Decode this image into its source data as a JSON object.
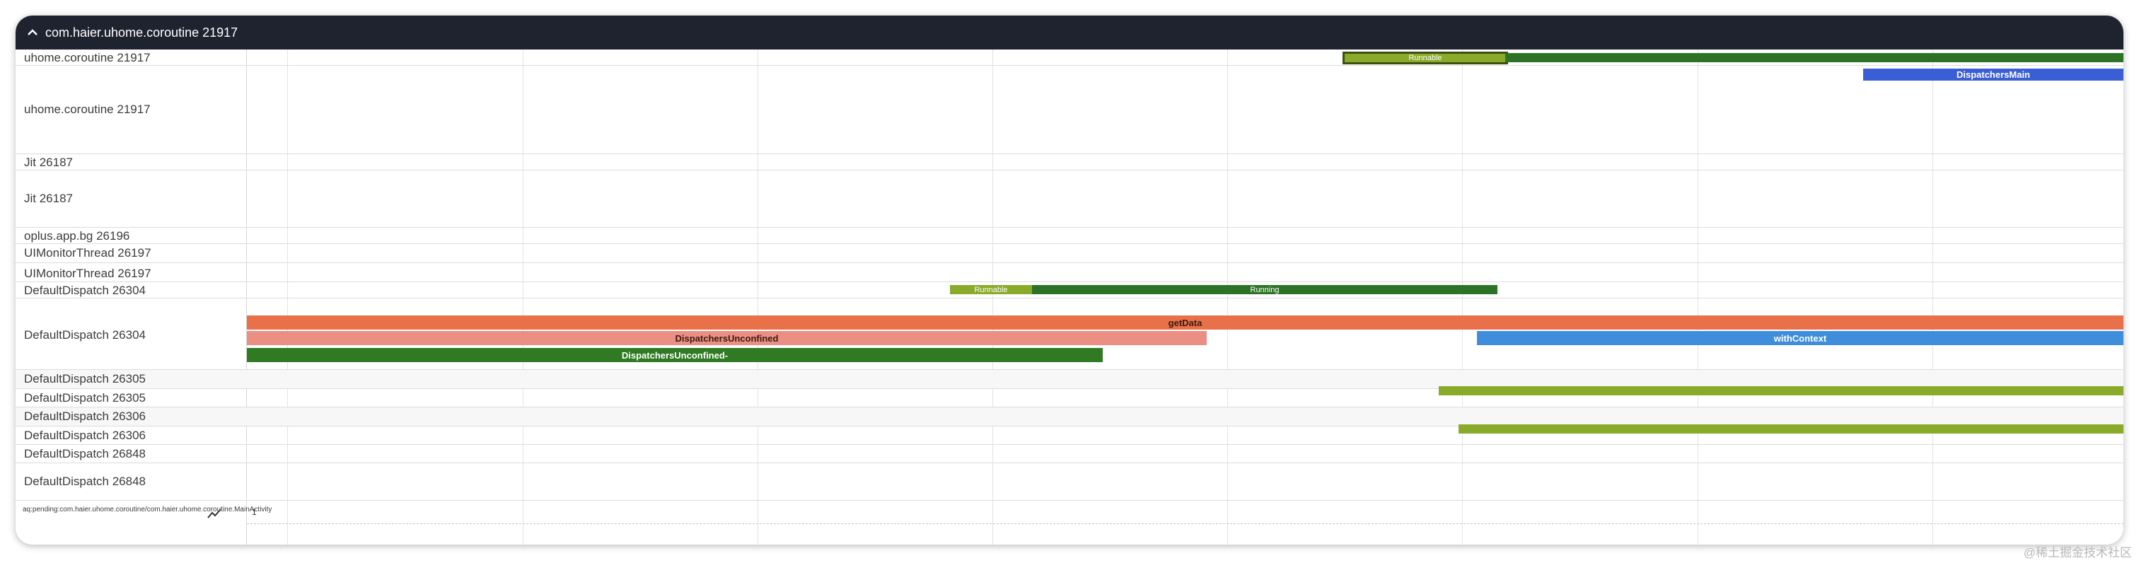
{
  "process": {
    "title": "com.haier.uhome.coroutine 21917"
  },
  "colors": {
    "runnable": "#8aaa2a",
    "running": "#2d7326",
    "dispatchers_main": "#3a5ed6",
    "get_data": "#e8714a",
    "dispatchers_unconfined": "#eb8f84",
    "with_context": "#3f8edc",
    "unconfined_dash": "#2f7a23",
    "header_bg": "#1f2330"
  },
  "tracks": [
    {
      "label": "uhome.coroutine 21917"
    },
    {
      "label": "uhome.coroutine 21917"
    },
    {
      "label": "Jit 26187"
    },
    {
      "label": "Jit 26187"
    },
    {
      "label": "oplus.app.bg 26196"
    },
    {
      "label": "UIMonitorThread 26197"
    },
    {
      "label": "UIMonitorThread 26197"
    },
    {
      "label": "DefaultDispatch 26304"
    },
    {
      "label": "DefaultDispatch 26304"
    },
    {
      "label": "DefaultDispatch 26305"
    },
    {
      "label": "DefaultDispatch 26305"
    },
    {
      "label": "DefaultDispatch 26306"
    },
    {
      "label": "DefaultDispatch 26306"
    },
    {
      "label": "DefaultDispatch 26848"
    },
    {
      "label": "DefaultDispatch 26848"
    }
  ],
  "slices": {
    "runnable_main": "Runnable",
    "dispatchers_main": "DispatchersMain",
    "runnable_26304": "Runnable",
    "running_26304": "Running",
    "get_data": "getData",
    "dispatchers_unconfined": "DispatchersUnconfined",
    "with_context": "withContext",
    "dispatchers_unconfined_dash": "DispatchersUnconfined-"
  },
  "counter": {
    "label": "aq:pending:com.haier.uhome.coroutine/com.haier.uhome.coroutine.MainActivity",
    "value": "1",
    "icon": "line-chart-icon"
  },
  "watermark": "@稀土掘金技术社区"
}
